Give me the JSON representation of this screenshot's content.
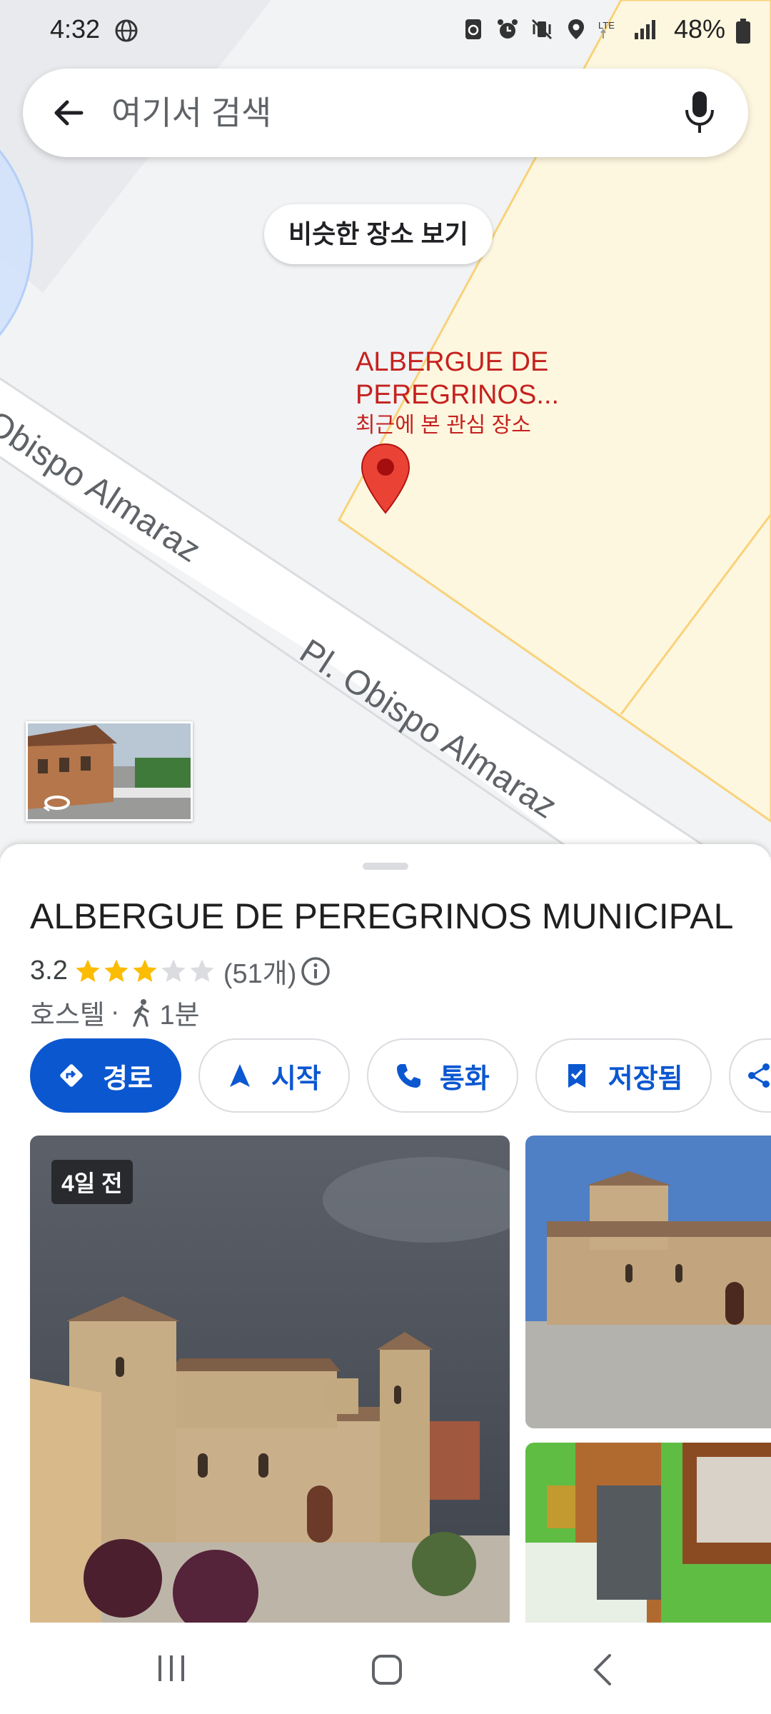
{
  "status_bar": {
    "time": "4:32",
    "network": "LTE",
    "battery": "48%"
  },
  "search": {
    "placeholder": "여기서 검색"
  },
  "map": {
    "similar_places_button": "비슷한 장소 보기",
    "road_label_1": "Obispo Almaraz",
    "road_label_2": "Pl. Obispo Almaraz",
    "pin_label_name": "ALBERGUE DE\nPEREGRINOS...",
    "pin_label_sub": "최근에 본 관심 장소",
    "colors": {
      "pin": "#ea4335",
      "label": "#c5221f",
      "land": "#f1f3f4",
      "parcel": "#fef7e0"
    }
  },
  "place": {
    "title": "ALBERGUE DE PEREGRINOS MUNICIPAL",
    "rating": "3.2",
    "stars_filled": 3,
    "stars_total": 5,
    "review_count": "(51개)",
    "category": "호스텔",
    "separator": "·",
    "walk_time": "1분"
  },
  "actions": {
    "directions": "경로",
    "start": "시작",
    "call": "통화",
    "saved": "저장됨"
  },
  "photos": {
    "main_badge": "4일 전"
  },
  "accent_color": "#0b57d0"
}
